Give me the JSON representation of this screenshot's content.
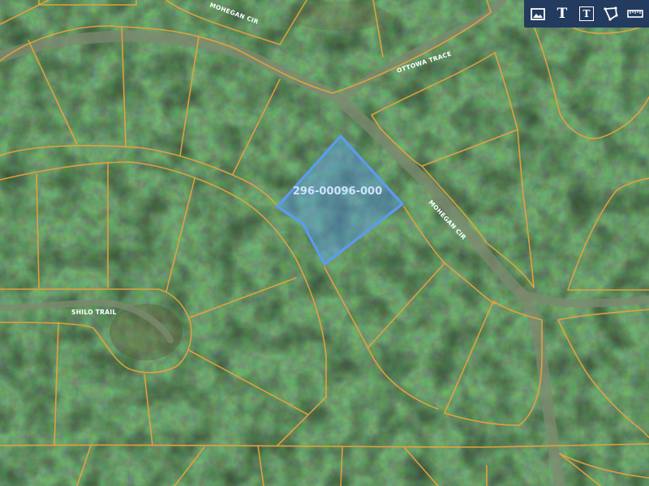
{
  "map": {
    "selected_parcel": {
      "id": "296-00096-000",
      "highlight_color": "#5b9bf0"
    },
    "parcel_line_color": "#e8a23a",
    "streets": {
      "mohegan_cir_top": "MOHEGAN CIR",
      "ottowa_trace": "OTTOWA TRACE",
      "mohegan_cir": "MOHEGAN CIR",
      "shilo_trail": "SHILO TRAIL"
    }
  },
  "toolbar": {
    "background": "#223b5e",
    "tools": [
      {
        "icon": "image-icon"
      },
      {
        "icon": "text-icon",
        "glyph": "T"
      },
      {
        "icon": "text-box-icon",
        "glyph": "T"
      },
      {
        "icon": "polygon-icon"
      },
      {
        "icon": "ruler-icon"
      }
    ]
  }
}
